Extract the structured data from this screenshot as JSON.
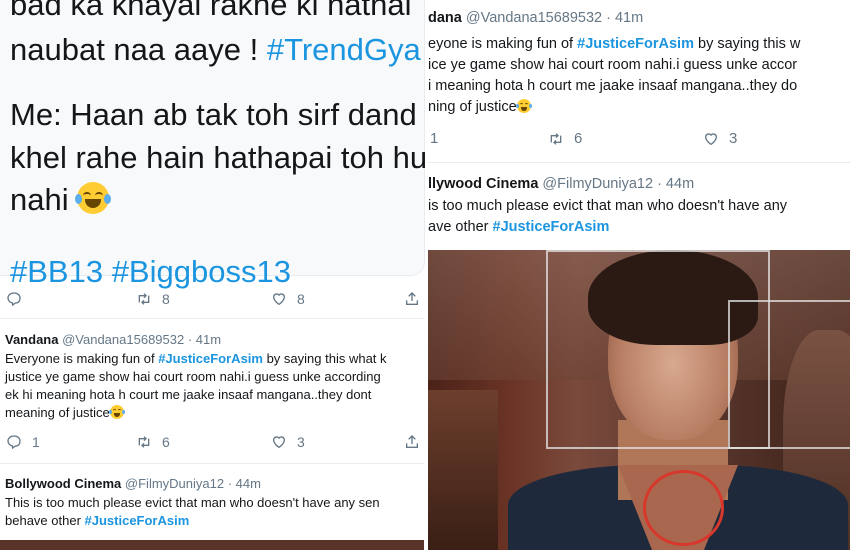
{
  "big_tweet": {
    "line0": "bad ka khayal rakhe ki nathai",
    "line1_text": "naubat naa aaye ! ",
    "line1_hashtag": "#TrendGya",
    "line2": "Me: Haan ab tak toh sirf dand",
    "line3": "khel rahe hain hathapai toh hu",
    "line4_text": "nahi ",
    "line5_hashtags": "#BB13  #Biggboss13",
    "emoji": "face-with-tears-of-joy",
    "replies": "",
    "retweets": "8",
    "likes": "8"
  },
  "left_tweets": [
    {
      "name": "Vandana",
      "handle": "@Vandana15689532",
      "time": "· 41m",
      "lines": [
        {
          "pre": "Everyone is making fun of ",
          "tag": "#JusticeForAsim",
          "post": " by saying this what k"
        },
        {
          "pre": "justice ye game show hai court room nahi.i guess unke according",
          "tag": "",
          "post": ""
        },
        {
          "pre": "ek hi meaning hota h court me jaake insaaf mangana..they dont",
          "tag": "",
          "post": ""
        },
        {
          "pre": "meaning of justice",
          "tag": "",
          "post": ""
        }
      ],
      "replies": "1",
      "retweets": "6",
      "likes": "3"
    },
    {
      "name": "Bollywood Cinema",
      "handle": "@FilmyDuniya12",
      "time": "· 44m",
      "lines": [
        {
          "pre": "This is too much please evict that man who doesn't have any sen",
          "tag": "",
          "post": ""
        },
        {
          "pre": "behave other ",
          "tag": "#JusticeForAsim",
          "post": ""
        }
      ]
    }
  ],
  "right_tweets": [
    {
      "name": "dana",
      "handle": "@Vandana15689532",
      "time": "· 41m",
      "lines": [
        {
          "pre": "eyone is making fun of ",
          "tag": "#JusticeForAsim",
          "post": " by saying this w"
        },
        {
          "pre": "ice ye game show hai court room nahi.i guess unke accor",
          "tag": "",
          "post": ""
        },
        {
          "pre": "i meaning hota h court me jaake insaaf mangana..they do",
          "tag": "",
          "post": ""
        },
        {
          "pre": "ning of justice",
          "tag": "",
          "post": ""
        }
      ],
      "replies": "1",
      "retweets": "6",
      "likes": "3"
    },
    {
      "name": "llywood Cinema",
      "handle": "@FilmyDuniya12",
      "time": "· 44m",
      "lines": [
        {
          "pre": "is too much please evict that man who doesn't have any",
          "tag": "",
          "post": ""
        },
        {
          "pre": "ave other ",
          "tag": "#JusticeForAsim",
          "post": ""
        }
      ]
    }
  ],
  "icons": {
    "reply": "reply-icon",
    "retweet": "retweet-icon",
    "like": "heart-icon",
    "share": "share-icon"
  },
  "colors": {
    "hashtag": "#1b95e0",
    "secondary_text": "#657786",
    "divider": "#e6ecf0",
    "highlight_circle": "#d8382c"
  }
}
